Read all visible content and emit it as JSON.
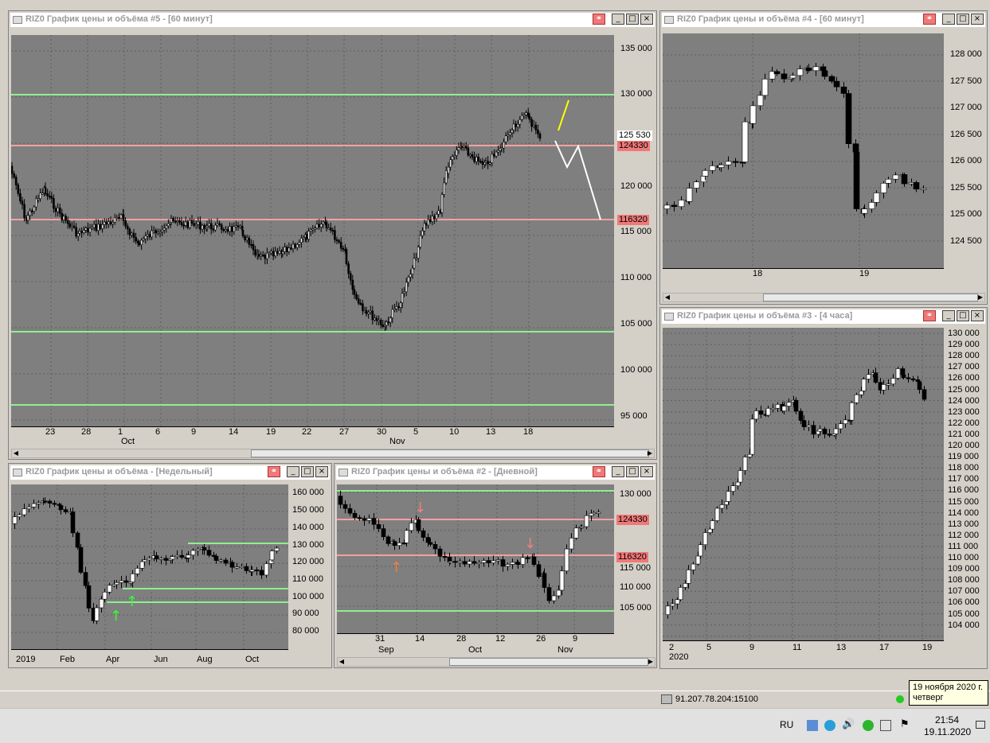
{
  "windows": {
    "w5": {
      "title": "RIZ0 График цены и объёма #5 - [60 минут]",
      "y_ticks": [
        "135 000",
        "130 000",
        "125 530",
        "124330",
        "120 000",
        "116320",
        "115 000",
        "110 000",
        "105 000",
        "100 000",
        "95 000"
      ],
      "x_ticks": [
        "23",
        "28",
        "1",
        "6",
        "9",
        "14",
        "19",
        "22",
        "27",
        "30",
        "5",
        "10",
        "13",
        "18"
      ],
      "x_months": [
        "Oct",
        "Nov"
      ]
    },
    "w4": {
      "title": "RIZ0 График цены и объёма #4 - [60 минут]",
      "y_ticks": [
        "128 000",
        "127 500",
        "127 000",
        "126 500",
        "126 000",
        "125 500",
        "125 000",
        "124 500"
      ],
      "x_ticks": [
        "18",
        "19"
      ]
    },
    "w3": {
      "title": "RIZ0 График цены и объёма #3 - [4 часа]",
      "y_ticks": [
        "130 000",
        "129 000",
        "128 000",
        "127 000",
        "126 000",
        "125 000",
        "124 000",
        "123 000",
        "122 000",
        "121 000",
        "120 000",
        "119 000",
        "118 000",
        "117 000",
        "116 000",
        "115 000",
        "114 000",
        "113 000",
        "112 000",
        "111 000",
        "110 000",
        "109 000",
        "108 000",
        "107 000",
        "106 000",
        "105 000",
        "104 000"
      ],
      "x_ticks": [
        "2",
        "5",
        "9",
        "11",
        "13",
        "17",
        "19"
      ],
      "x_year": "2020"
    },
    "w1": {
      "title": "RIZ0 График цены и объёма - [Недельный]",
      "y_ticks": [
        "160 000",
        "150 000",
        "140 000",
        "130 000",
        "120 000",
        "110 000",
        "100 000",
        "90 000",
        "80 000"
      ],
      "x_ticks": [
        "2019",
        "Feb",
        "Apr",
        "Jun",
        "Aug",
        "Oct"
      ]
    },
    "w2": {
      "title": "RIZ0 График цены и объёма #2 - [Дневной]",
      "y_ticks": [
        "130 000",
        "124330",
        "116320",
        "115 000",
        "110 000",
        "105 000"
      ],
      "x_ticks": [
        "31",
        "14",
        "28",
        "12",
        "26",
        "9"
      ],
      "x_months": [
        "Sep",
        "Oct",
        "Nov"
      ]
    }
  },
  "btn": {
    "min": "_",
    "max": "□",
    "close": "×",
    "link": "⚭"
  },
  "status": {
    "server": "91.207.78.204:15100"
  },
  "taskbar": {
    "lang": "RU",
    "time": "21:54",
    "date": "19.11.2020"
  },
  "tooltip": {
    "line1": "19 ноября 2020 г.",
    "line2": "четверг"
  },
  "colors": {
    "plot_bg": "#7f7f7f",
    "green_level": "#90ee90",
    "red_level": "#f07878",
    "bull": "#ffffff",
    "bear": "#000000"
  }
}
